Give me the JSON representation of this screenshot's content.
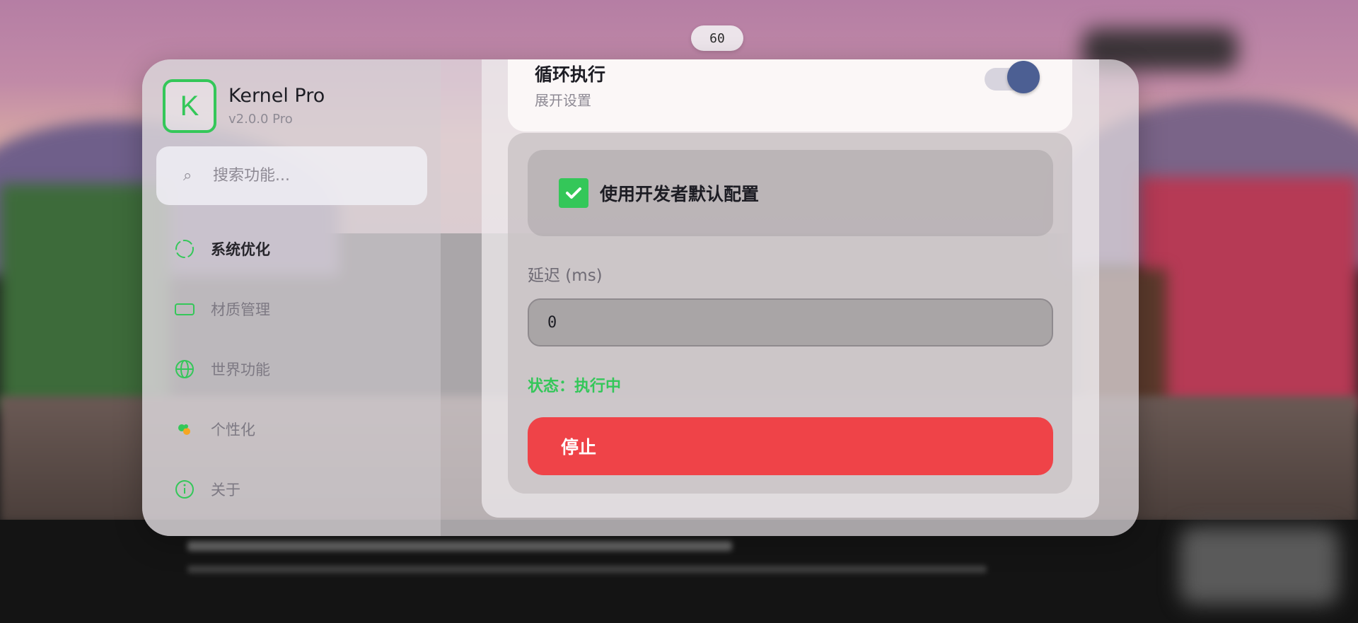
{
  "fps": "60",
  "app": {
    "title": "Kernel Pro",
    "version": "v2.0.0 Pro",
    "logo_letter": "K",
    "accent_color": "#34c759"
  },
  "search": {
    "icon": "search-icon",
    "placeholder": "搜索功能..."
  },
  "sidebar": {
    "items": [
      {
        "label": "系统优化",
        "icon": "system-optimize-icon",
        "active": true
      },
      {
        "label": "材质管理",
        "icon": "texture-icon",
        "active": false
      },
      {
        "label": "世界功能",
        "icon": "globe-icon",
        "active": false
      },
      {
        "label": "个性化",
        "icon": "palette-icon",
        "active": false
      },
      {
        "label": "关于",
        "icon": "info-icon",
        "active": false
      }
    ]
  },
  "loop": {
    "title": "循环执行",
    "subtitle": "展开设置",
    "toggle_on": true,
    "toggle_color": "#4c5f93"
  },
  "settings": {
    "dev_default_label": "使用开发者默认配置",
    "dev_default_checked": true,
    "delay_label": "延迟 (ms)",
    "delay_value": "0",
    "status_text": "状态：执行中",
    "status_color": "#34c759",
    "stop_label": "停止",
    "stop_color": "#ef4348"
  }
}
